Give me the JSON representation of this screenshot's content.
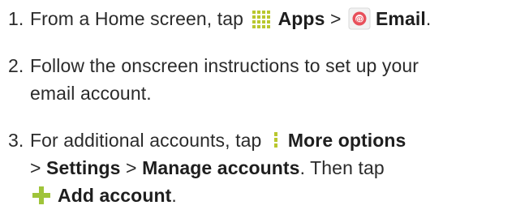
{
  "steps": [
    {
      "number": "1.",
      "lines": {
        "l1": {
          "t1": "From a Home screen, tap ",
          "apps": "Apps",
          "sep1": " > ",
          "email": "Email",
          "end": "."
        }
      }
    },
    {
      "number": "2.",
      "lines": {
        "l1": {
          "t1": "Follow the onscreen instructions to set up your"
        },
        "l2": {
          "t1": "email account."
        }
      }
    },
    {
      "number": "3.",
      "lines": {
        "l1": {
          "t1": "For additional accounts, tap ",
          "more": "More options"
        },
        "l2": {
          "sep1": "> ",
          "settings": "Settings",
          "sep2": " > ",
          "manage": "Manage accounts",
          "t2": ". Then tap"
        },
        "l3": {
          "add": "Add account",
          "end": "."
        }
      }
    }
  ],
  "icons": {
    "apps": "apps-grid-icon",
    "email": "email-app-icon",
    "more": "more-options-icon",
    "add": "add-icon"
  },
  "colors": {
    "text": "#2b2b2b",
    "apps_icon": "#b9c72e",
    "email_icon_ring": "#e8505b",
    "more_icon": "#b9c72e",
    "add_icon": "#9fc43a"
  }
}
